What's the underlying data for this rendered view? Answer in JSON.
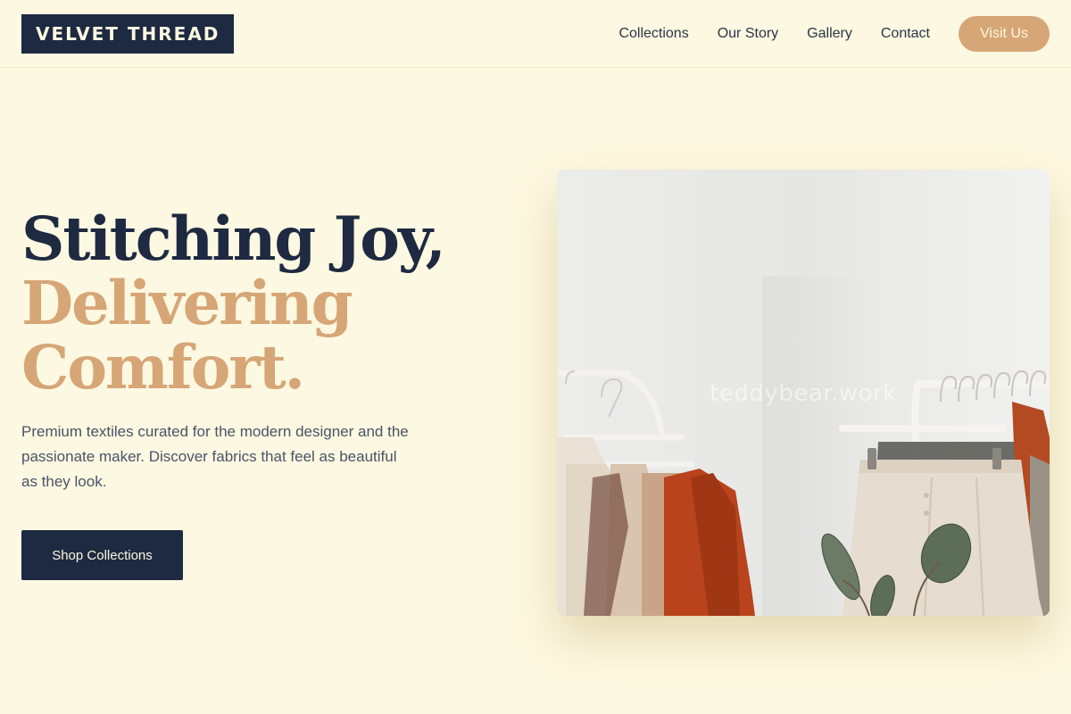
{
  "brand": {
    "name": "VELVET THREAD"
  },
  "nav": {
    "links": [
      "Collections",
      "Our Story",
      "Gallery",
      "Contact"
    ],
    "cta": "Visit Us"
  },
  "hero": {
    "headline_line1": "Stitching Joy,",
    "headline_line2": "Delivering",
    "headline_line3": "Comfort.",
    "description": "Premium textiles curated for the modern designer and the passionate maker. Discover fabrics that feel as beautiful as they look.",
    "button": "Shop Collections",
    "image_watermark": "teddybear.work"
  },
  "colors": {
    "background": "#fdf8e1",
    "navy": "#1e2a41",
    "accent": "#d6a676"
  }
}
